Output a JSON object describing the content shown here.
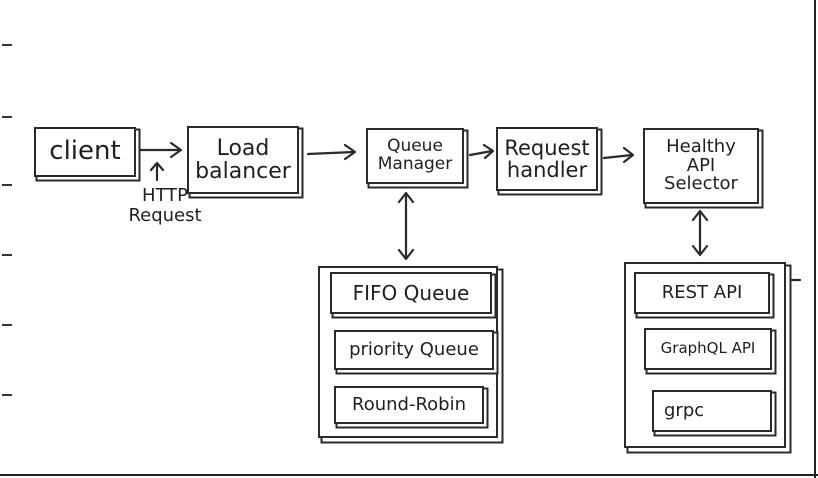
{
  "diagram": {
    "nodes": {
      "client": "client",
      "load_balancer": "Load\nbalancer",
      "queue_manager": "Queue\nManager",
      "request_handler": "Request\nhandler",
      "healthy_api_selector": "Healthy\nAPI\nSelector"
    },
    "edge_labels": {
      "http_request": "HTTP\nRequest"
    },
    "queue_group": {
      "items": [
        "FIFO Queue",
        "priority Queue",
        "Round-Robin"
      ]
    },
    "api_group": {
      "items": [
        "REST API",
        "GraphQL API",
        "grpc"
      ]
    }
  }
}
